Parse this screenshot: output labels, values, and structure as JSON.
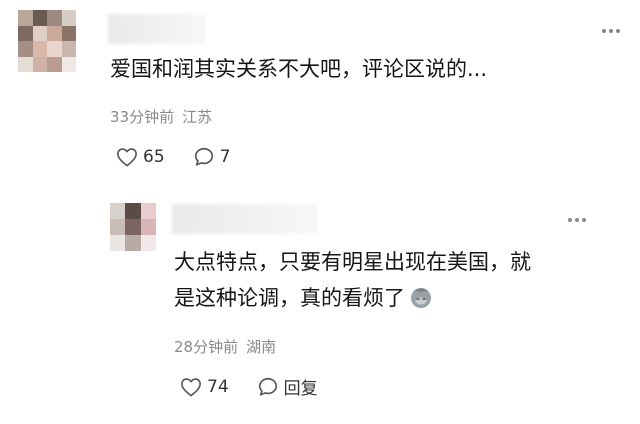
{
  "comments": [
    {
      "text": "爱国和润其实关系不大吧，评论区说的...",
      "time": "33分钟前",
      "location": "江苏",
      "likes": "65",
      "replies": "7",
      "icons": {
        "like": "heart-outline-icon",
        "comment": "speech-bubble-icon",
        "more": "three-dots-icon"
      }
    },
    {
      "text_line1": "大点特点，只要有明星出现在美国，就",
      "text_line2": "是这种论调，真的看烦了",
      "emoji": "facepalm-emoji-icon",
      "time": "28分钟前",
      "location": "湖南",
      "likes": "74",
      "reply_label": "回复",
      "icons": {
        "like": "heart-outline-icon",
        "comment": "speech-bubble-icon",
        "more": "three-dots-icon"
      }
    }
  ],
  "colors": {
    "text": "#151515",
    "meta": "#8a8a8a",
    "icon": "#555555",
    "background": "#ffffff"
  }
}
